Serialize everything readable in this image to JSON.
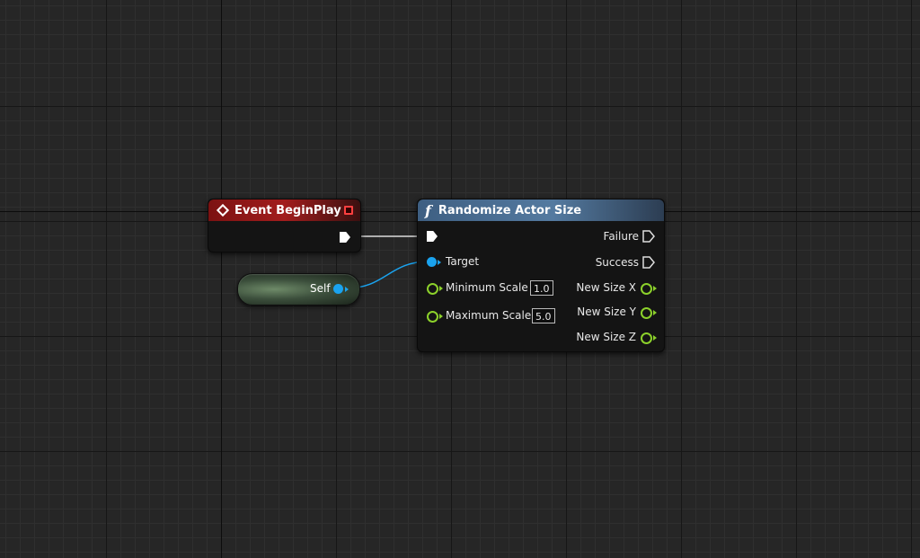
{
  "event_node": {
    "title": "Event BeginPlay",
    "icon": "diamond-event-icon",
    "header_color": "#a21d1d"
  },
  "self_node": {
    "label": "Self"
  },
  "function_node": {
    "title": "Randomize Actor Size",
    "icon": "function-f-icon",
    "header_color": "#547aa0",
    "inputs": {
      "target": "Target",
      "minimum_scale": "Minimum Scale",
      "minimum_scale_value": "1.0",
      "maximum_scale": "Maximum Scale",
      "maximum_scale_value": "5.0"
    },
    "outputs": {
      "failure": "Failure",
      "success": "Success",
      "new_size_x": "New Size X",
      "new_size_y": "New Size Y",
      "new_size_z": "New Size Z"
    }
  },
  "colors": {
    "exec_wire": "#e0e0e0",
    "object_pin": "#1aa3ef",
    "float_pin": "#8cd12b"
  }
}
